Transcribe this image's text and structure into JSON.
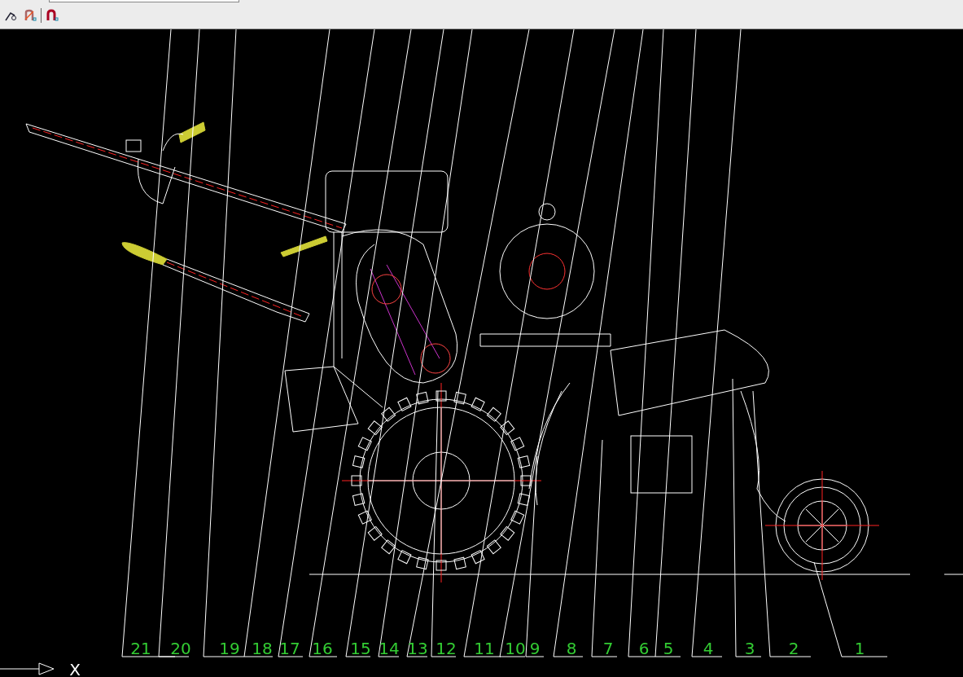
{
  "drawing": {
    "part_labels": [
      {
        "text": "21"
      },
      {
        "text": "20"
      },
      {
        "text": "19"
      },
      {
        "text": "18"
      },
      {
        "text": "17"
      },
      {
        "text": "16"
      },
      {
        "text": "15"
      },
      {
        "text": "14"
      },
      {
        "text": "13"
      },
      {
        "text": "12"
      },
      {
        "text": "11"
      },
      {
        "text": "10"
      },
      {
        "text": "9"
      },
      {
        "text": "8"
      },
      {
        "text": "7"
      },
      {
        "text": "6"
      },
      {
        "text": "5"
      },
      {
        "text": "4"
      },
      {
        "text": "3"
      },
      {
        "text": "2"
      },
      {
        "text": "1"
      }
    ],
    "axis_label": "X"
  }
}
